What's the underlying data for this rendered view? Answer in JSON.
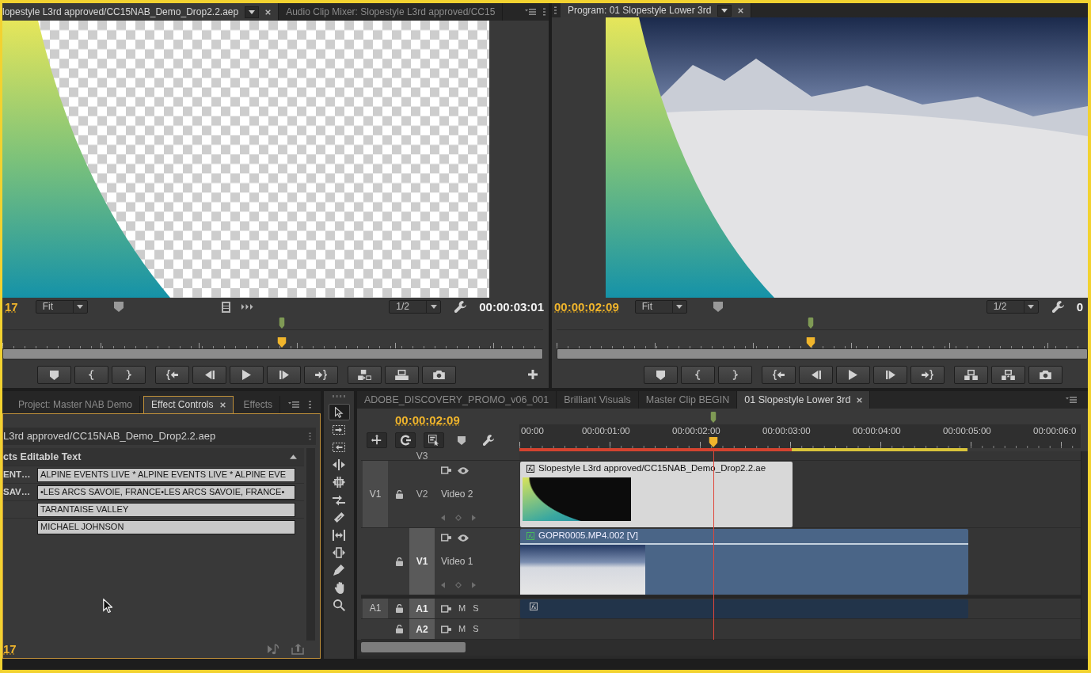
{
  "source_monitor": {
    "tabs": [
      {
        "label": "lopestyle L3rd approved/CC15NAB_Demo_Drop2.2.aep",
        "selected": true
      },
      {
        "label": "Audio Clip Mixer: Slopestyle L3rd approved/CC15",
        "selected": false
      }
    ],
    "timecode_current": "17",
    "zoom": "Fit",
    "resolution": "1/2",
    "timecode_duration": "00:00:03:01",
    "scrubber": {
      "level": 0.517
    }
  },
  "program_monitor": {
    "tabs": [
      {
        "label": "Program: 01 Slopestyle Lower 3rd",
        "selected": true
      }
    ],
    "timecode_current": "00:00:02:09",
    "zoom": "Fit",
    "resolution": "1/2",
    "timecode_duration": "0",
    "scrubber": {
      "level": 0.478
    }
  },
  "effect_controls": {
    "tabs": [
      {
        "label": "Project: Master NAB Demo",
        "selected": false
      },
      {
        "label": "Effect Controls",
        "selected": true
      },
      {
        "label": "Effects",
        "selected": false
      }
    ],
    "clip_name": "L3rd approved/CC15NAB_Demo_Drop2.2.aep",
    "section_title": "cts Editable Text",
    "properties": [
      {
        "label": "ENT…",
        "value": "ALPINE EVENTS LIVE * ALPINE EVENTS LIVE * ALPINE EVE"
      },
      {
        "label": "SAV…",
        "value": "•LES ARCS SAVOIE, FRANCE•LES ARCS SAVOIE, FRANCE•"
      },
      {
        "value": "TARANTAISE VALLEY"
      },
      {
        "value": "MICHAEL JOHNSON"
      }
    ],
    "timecode": "17"
  },
  "tools": [
    {
      "selected": true
    },
    {
      "selected": false
    },
    {
      "selected": false
    },
    {
      "selected": false
    },
    {
      "selected": false
    },
    {
      "selected": false
    },
    {
      "selected": false
    },
    {
      "selected": false
    },
    {
      "selected": false
    },
    {
      "selected": false
    },
    {
      "selected": false
    },
    {
      "selected": false
    }
  ],
  "timeline": {
    "tabs": [
      {
        "label": "ADOBE_DISCOVERY_PROMO_v06_001",
        "selected": false
      },
      {
        "label": "Brilliant Visuals",
        "selected": false
      },
      {
        "label": "Master Clip BEGIN",
        "selected": false
      },
      {
        "label": "01 Slopestyle Lower 3rd",
        "selected": true
      }
    ],
    "timecode": "00:00:02:09",
    "ruler_labels": [
      "00:00",
      "00:00:01:00",
      "00:00:02:00",
      "00:00:03:00",
      "00:00:04:00",
      "00:00:05:00",
      "00:00:06:0"
    ],
    "playhead": {
      "level": 0.346
    },
    "tracks": [
      {
        "kind": "partial",
        "target": "V3"
      },
      {
        "kind": "video",
        "source": "V1",
        "target": "V2",
        "targeted": false,
        "name": "Video 2",
        "clip": {
          "kind": "graphic",
          "label": "Slopestyle L3rd approved/CC15NAB_Demo_Drop2.2.ae"
        }
      },
      {
        "kind": "video",
        "target": "V1",
        "targeted": true,
        "name": "Video 1",
        "clip": {
          "kind": "video",
          "label": "GOPR0005.MP4.002 [V]"
        }
      },
      {
        "kind": "audio",
        "source": "A1",
        "target": "A1",
        "targeted": true,
        "mute": "M",
        "solo": "S",
        "clip": {
          "kind": "audio"
        }
      },
      {
        "kind": "audio",
        "target": "A2",
        "targeted": true,
        "mute": "M",
        "solo": "S"
      }
    ]
  }
}
